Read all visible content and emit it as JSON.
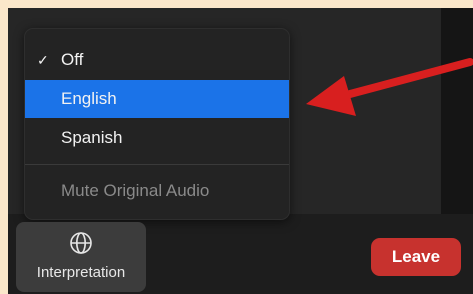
{
  "menu": {
    "items": [
      {
        "label": "Off",
        "checked": true
      },
      {
        "label": "English",
        "selected": true
      },
      {
        "label": "Spanish"
      },
      {
        "label": "Mute Original Audio",
        "disabled": true
      }
    ]
  },
  "toolbar": {
    "interpretation_label": "Interpretation",
    "interpretation_icon": "globe-icon",
    "leave_label": "Leave"
  },
  "annotation": {
    "arrow_color": "#d81f1f",
    "arrow_icon": "red-arrow-icon"
  },
  "colors": {
    "frame": "#fae7ca",
    "selected": "#1b73e8",
    "leave": "#c7322e"
  }
}
